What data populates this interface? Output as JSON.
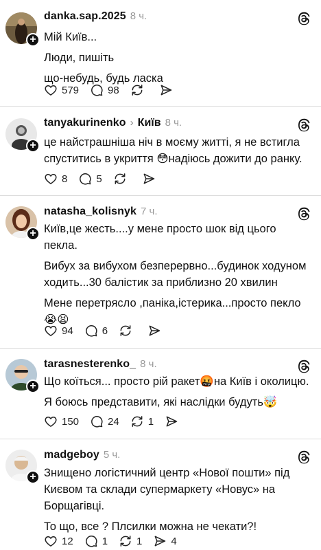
{
  "posts": [
    {
      "username": "danka.sap.2025",
      "time": "8 ч.",
      "lines": [
        "Мій Київ...",
        "Люди, пишіть",
        "що-небудь, будь ласка"
      ],
      "likes": "579",
      "comments": "98",
      "reposts": "",
      "shares": ""
    },
    {
      "username": "tanyakurinenko",
      "topic": "Київ",
      "time": "8 ч.",
      "lines": [
        "це найстрашніша ніч в моєму житті, я не встигла",
        "спуститись в укриття 😳надіюсь дожити до ранку."
      ],
      "likes": "8",
      "comments": "5",
      "reposts": "",
      "shares": ""
    },
    {
      "username": "natasha_kolisnyk",
      "time": "7 ч.",
      "lines": [
        "Київ,це жесть....у мене просто шок від цього",
        "пекла.",
        "Вибух за вибухом безперервно...будинок ходуном",
        "ходить...30 балістик за приблизно  20 хвилин",
        "Мене  перетрясло ,паніка,істерика...просто пекло",
        "😭😫"
      ],
      "likes": "94",
      "comments": "6",
      "reposts": "",
      "shares": ""
    },
    {
      "username": "tarasnesterenko_",
      "time": "8 ч.",
      "lines": [
        "Що коїться... просто рій ракет🤬на Київ і околицю.",
        "Я боюсь представити, які наслідки будуть🤯"
      ],
      "likes": "150",
      "comments": "24",
      "reposts": "1",
      "shares": ""
    },
    {
      "username": "madgeboy",
      "time": "5 ч.",
      "lines": [
        "Знищено логістичний центр «Нової пошти» під",
        "Києвом та склади супермаркету «Новус» на",
        "Борщагівці.",
        "То що, все ? Плсилки можна не чекати?!"
      ],
      "likes": "12",
      "comments": "1",
      "reposts": "1",
      "shares": "4"
    }
  ],
  "icons": {
    "like": "heart-icon",
    "comment": "comment-bubble-icon",
    "repost": "repost-icon",
    "share": "share-send-icon",
    "follow": "plus-follow-icon",
    "app": "threads-logo-icon"
  }
}
